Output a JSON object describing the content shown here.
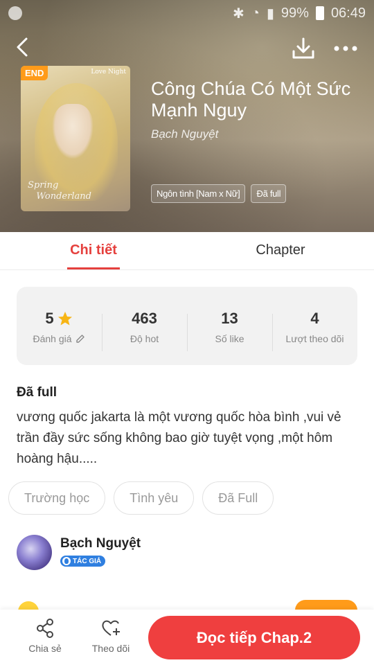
{
  "status_bar": {
    "battery": "99%",
    "time": "06:49"
  },
  "book": {
    "badge": "END",
    "cover_title": "Love Night",
    "cover_caption_line1": "Spring",
    "cover_caption_line2": "Wonderland",
    "title": "Công Chúa Có Một Sức Mạnh Nguy",
    "author": "Bạch Nguyệt",
    "genres": [
      "Ngôn tình [Nam x Nữ]",
      "Đã full"
    ]
  },
  "tabs": [
    {
      "label": "Chi tiết",
      "active": true
    },
    {
      "label": "Chapter",
      "active": false
    }
  ],
  "stats": [
    {
      "value": "5",
      "label": "Đánh giá",
      "icon": "star-icon"
    },
    {
      "value": "463",
      "label": "Độ hot"
    },
    {
      "value": "13",
      "label": "Số like"
    },
    {
      "value": "4",
      "label": "Lượt theo dõi"
    }
  ],
  "status_title": "Đã full",
  "description": "vương quốc jakarta là một vương quốc hòa bình ,vui vẻ trần đầy sức sống không bao giờ tuyệt vọng ,một hôm hoàng hậu.....",
  "tags": [
    "Trường học",
    "Tình yêu",
    "Đã Full"
  ],
  "author_card": {
    "name": "Bạch Nguyệt",
    "role_badge": "TÁC GIẢ"
  },
  "bottom_bar": {
    "share_label": "Chia sẻ",
    "follow_label": "Theo dõi",
    "read_label": "Đọc tiếp Chap.2"
  },
  "colors": {
    "accent": "#e5403d",
    "read_button": "#ef3f3f",
    "badge_orange": "#ff9b1a",
    "author_badge": "#2f7fe0"
  }
}
